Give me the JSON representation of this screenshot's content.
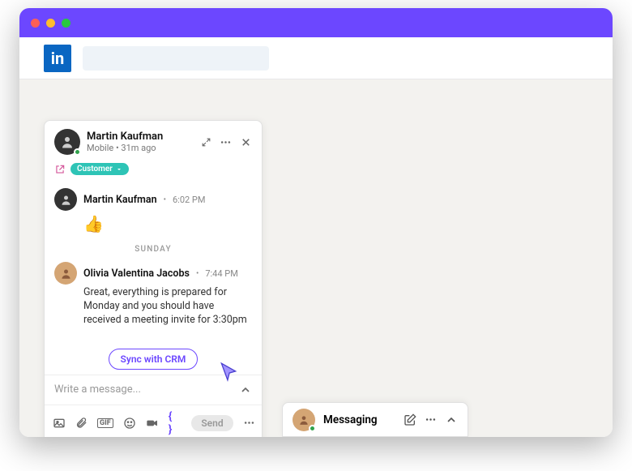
{
  "header": {
    "logo_text": "in"
  },
  "chat": {
    "contact_name": "Martin Kaufman",
    "contact_sub": "Mobile  •  31m ago",
    "badge": "Customer",
    "messages": [
      {
        "author": "Martin Kaufman",
        "time": "6:02 PM",
        "reaction": "👍"
      },
      {
        "day": "SUNDAY"
      },
      {
        "author": "Olivia Valentina Jacobs",
        "time": "7:44 PM",
        "text": "Great, everything is prepared for Monday and you should have received a meeting invite for 3:30pm"
      }
    ],
    "sync_label": "Sync with CRM",
    "compose_placeholder": "Write a message...",
    "send_label": "Send",
    "gif_label": "GIF"
  },
  "messaging_bar": {
    "title": "Messaging"
  }
}
